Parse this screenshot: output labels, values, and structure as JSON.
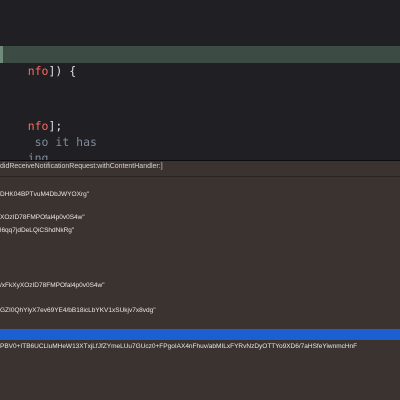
{
  "editor": {
    "lines": [
      {
        "var": "nfo",
        "rest": "]) {"
      },
      {
        "var": "nfo",
        "rest": "];"
      },
      {
        "comment": " so it has"
      },
      {
        "comment": "ing."
      }
    ]
  },
  "console": {
    "header": "didReceiveNotificationRequest:withContentHandler:]",
    "logs": [
      "DHK04BPTvuM4DbJWYOXrg\"",
      "XOzID78FMPOfal4p0v0S4w\"",
      "l6qq7jdDeLQiCShdNkRg\"",
      "/xFkXyXOzID78FMPOfal4p0v0S4w\"",
      "GZI0QhYlyX7ev69YE4/bB18icLbYKV1xSUkjv7x8vdg\"",
      "PBV0+ITB6UCLluMHeW13XTxjLfJfZYmeLUu7GUcz0+FPgoIAX4nFhuv/abMILxFYRvNzDyOTTYo9XD6/7aHSfeYiwnmcHnF"
    ]
  }
}
